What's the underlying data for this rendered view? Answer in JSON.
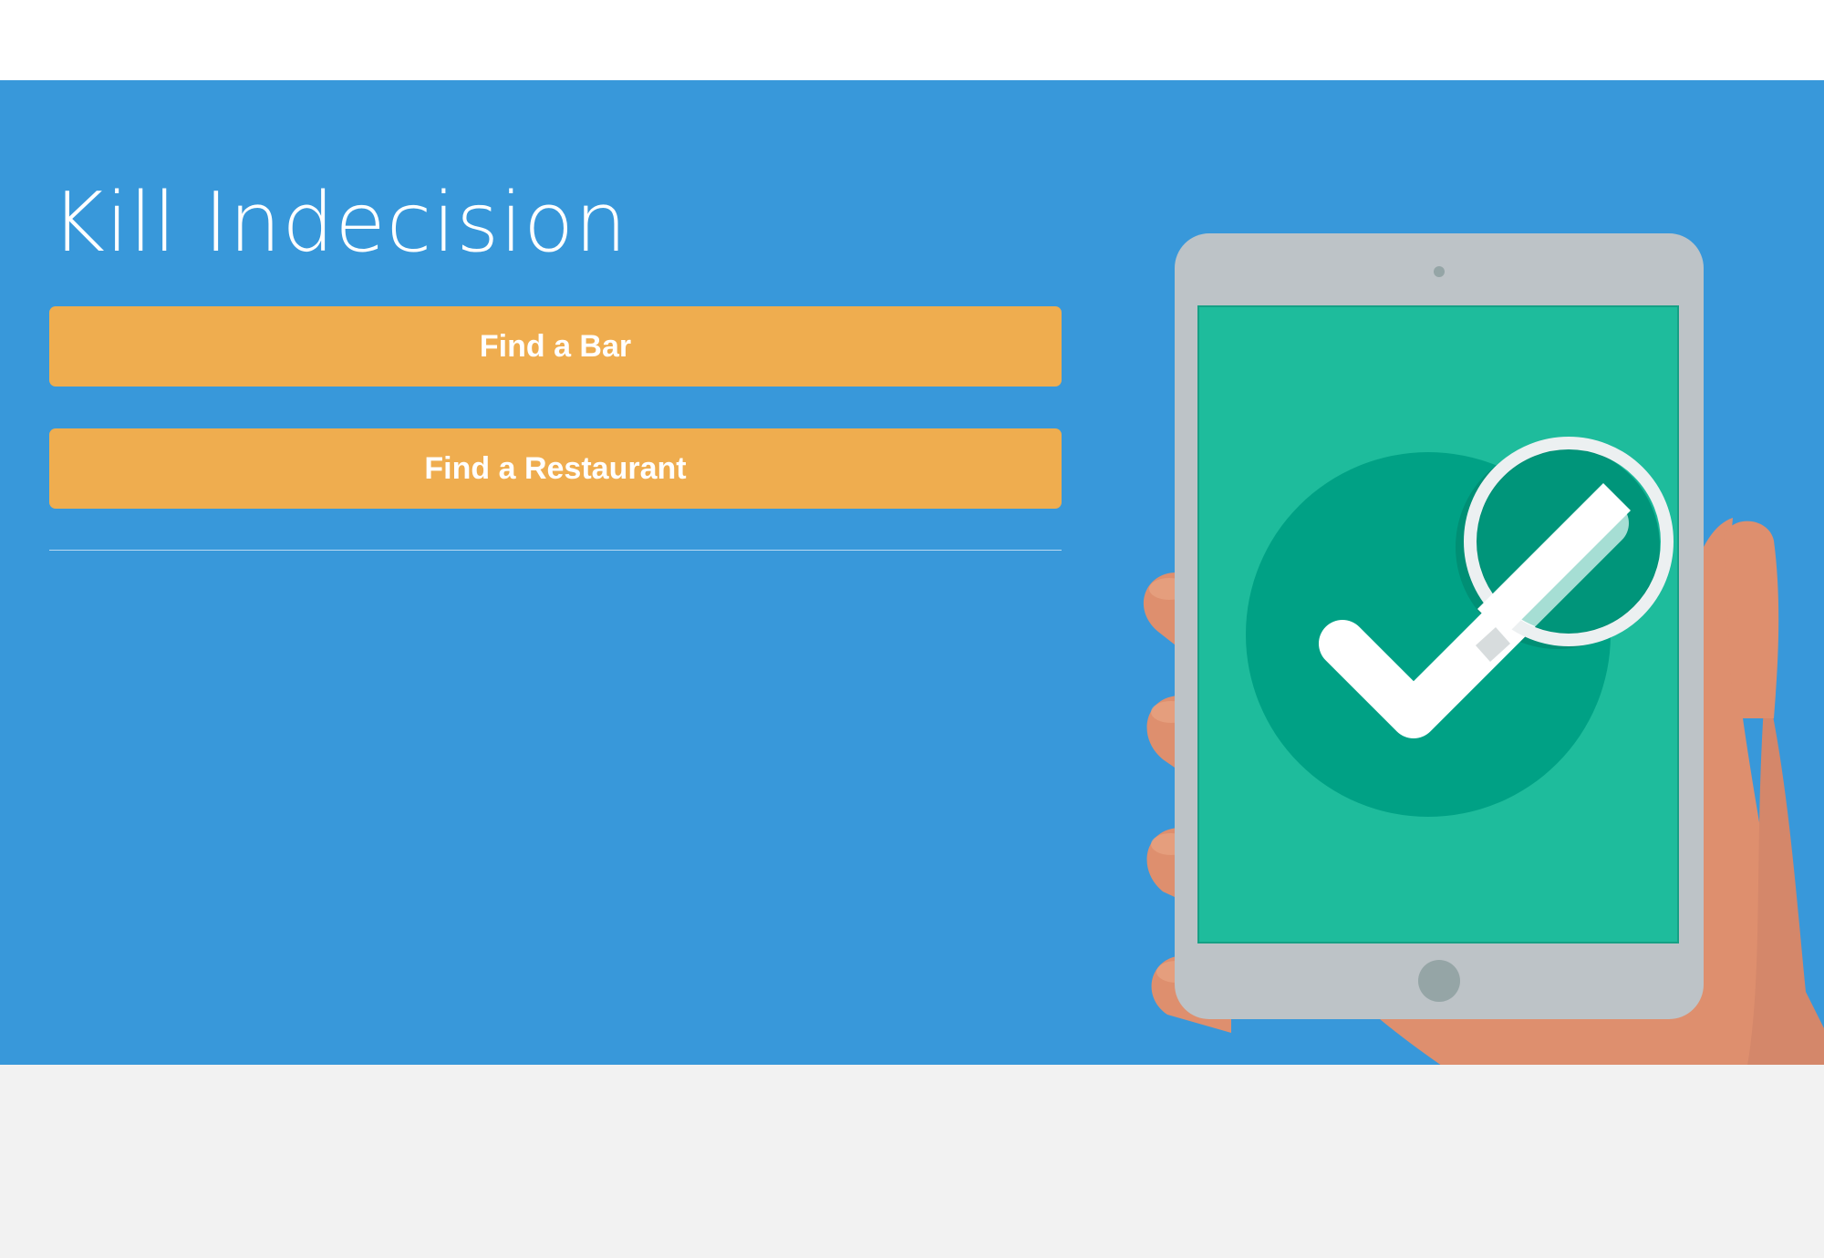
{
  "hero": {
    "title": "Kill Indecision"
  },
  "actions": {
    "find_bar_label": "Find a Bar",
    "find_restaurant_label": "Find a Restaurant"
  },
  "colors": {
    "hero_background": "#3898da",
    "button": "#efad4f",
    "button_text": "#ffffff",
    "footer_background": "#f2f2f2",
    "screen": "#1ebc9c",
    "check_circle": "#00a185",
    "skin": "#de8f6e"
  },
  "icons": {
    "illustration": "tablet-checkmark-illustration",
    "check": "checkmark-icon",
    "magnifier": "magnifier-icon"
  }
}
